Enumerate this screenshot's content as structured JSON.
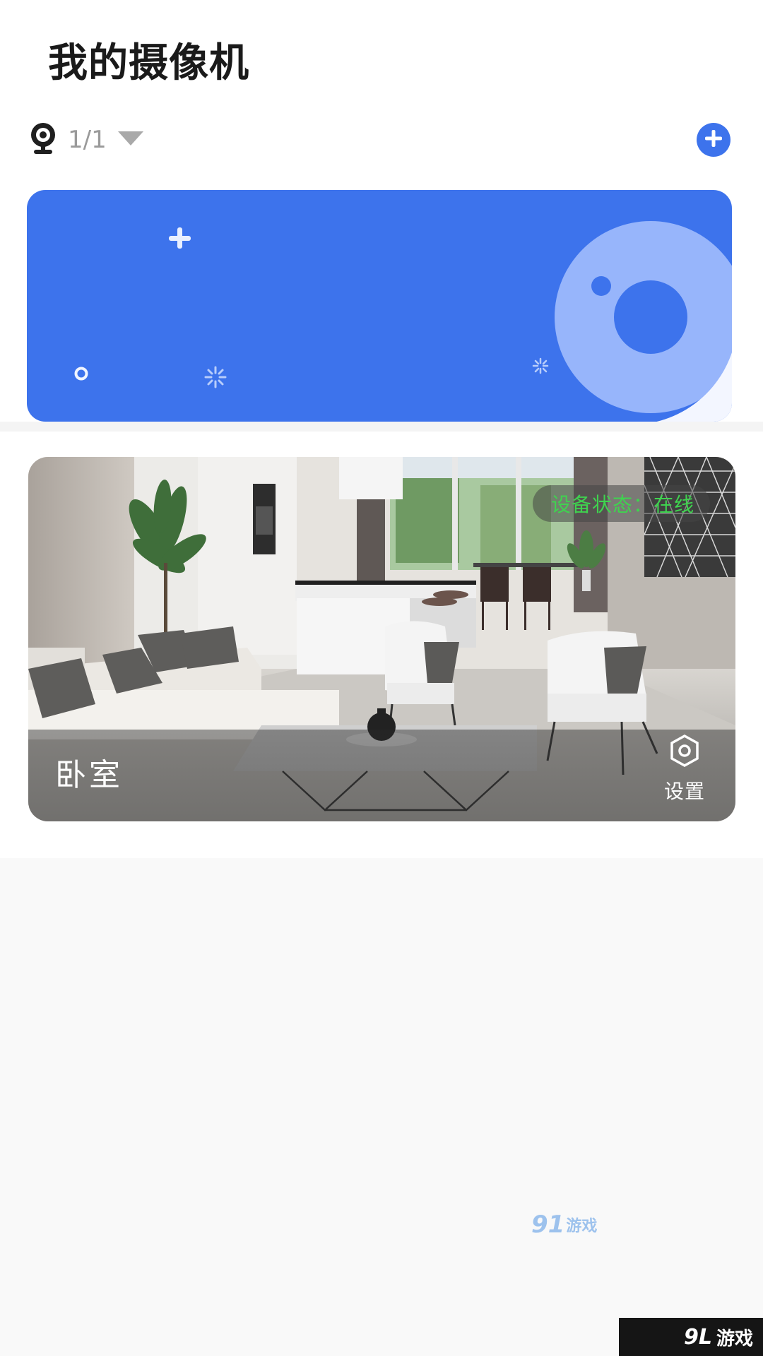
{
  "header": {
    "title": "我的摄像机"
  },
  "device_selector": {
    "count": "1/1",
    "icon": "webcam-icon",
    "dropdown_icon": "triangle-down-icon"
  },
  "add_button": {
    "icon": "plus-icon"
  },
  "banner": {
    "color": "#3d73ec"
  },
  "camera_card": {
    "name": "卧室",
    "status_text": "设备状态：在线",
    "status_color": "#3fd34f",
    "settings_label": "设置",
    "settings_icon": "hexagon-gear-icon"
  },
  "watermark": {
    "logo": "91",
    "text": "游戏"
  },
  "corner_badge": {
    "logo": "9L",
    "text": "游戏"
  }
}
